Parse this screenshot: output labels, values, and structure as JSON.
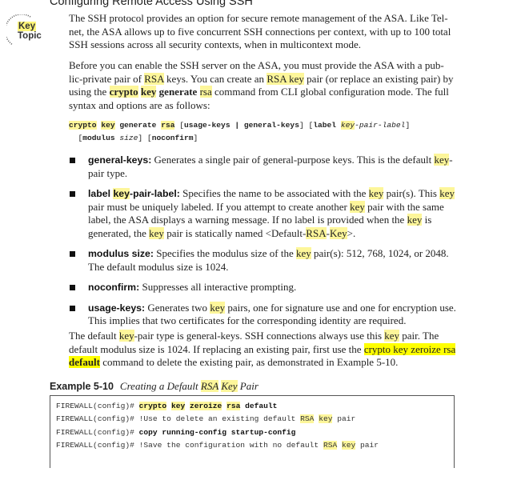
{
  "section": {
    "heading": "Configuring Remote Access Using SSH",
    "key_topic": {
      "line1": "Key",
      "line2": "Topic"
    }
  },
  "paragraph1": {
    "text": "The SSH protocol provides an option for secure remote management of the ASA. Like Tel-net, the ASA allows up to five concurrent SSH connections per context, with up to 100 total SSH sessions across all security contexts, when in multicontext mode."
  },
  "paragraph2": {
    "t1": "Before you can enable the SSH server on the ASA, you must provide the ASA with a pub-lic-private pair of ",
    "rsa1": "RSA",
    "t2": " keys. You can create an ",
    "rsa2": "RSA",
    "sp": " ",
    "key1": "key",
    "t3": " pair (or replace an existing pair) by using the ",
    "crypto": "crypto",
    "key2": "key",
    "generate": "generate",
    "rsa3": "rsa",
    "t4": " command from CLI global configuration mode. The full syntax and options are as follows:"
  },
  "syntax": {
    "crypto": "crypto",
    "key": "key",
    "generate": "generate",
    "rsa": "rsa",
    "ob1": "[",
    "usage_keys": "usage-keys",
    "pipe": " | ",
    "general_keys": "general-keys",
    "cb1": "]",
    "ob2": "[",
    "label": "label",
    "keyword_key": "key",
    "pair_label": "-pair-label",
    "cb2": "]",
    "ob3": "[",
    "modulus": "modulus",
    "size": "size",
    "cb3": "]",
    "ob4": "[",
    "noconfirm": "noconfirm",
    "cb4": "]"
  },
  "bullets": [
    {
      "term": "general-keys:",
      "t1": " Generates a single pair of general-purpose keys. This is the default ",
      "k1": "key",
      "t2": "-pair type."
    },
    {
      "term_pre": "label ",
      "term_key": "key",
      "term_post": "-pair-label:",
      "t1": " Specifies the name to be associated with the ",
      "k1": "key",
      "t2": " pair(s). This ",
      "k2": "key",
      "t3": " pair must be uniquely labeled. If you attempt to create another ",
      "k3": "key",
      "t4": " pair with the same label, the ASA displays a warning message. If no label is provided when the ",
      "k4": "key",
      "t5": " is generated, the ",
      "k5": "key",
      "t6": " pair is statically named <Default-",
      "rsa": "RSA",
      "dash": "-",
      "k6": "Key",
      "t7": ">."
    },
    {
      "term": "modulus size:",
      "t1": " Specifies the modulus size of the ",
      "k1": "key",
      "t2": " pair(s): 512, 768, 1024, or 2048. The default modulus size is 1024."
    },
    {
      "term": "noconfirm:",
      "t1": " Suppresses all interactive prompting."
    },
    {
      "term": "usage-keys:",
      "t1": " Generates two ",
      "k1": "key",
      "t2": " pairs, one for signature use and one for encryption use. This implies that two certificates for the corresponding identity are required."
    }
  ],
  "paragraph3": {
    "t1": "The default ",
    "k1": "key",
    "t2": "-pair type is general-keys. SSH connections always use this ",
    "k2": "key",
    "t3": " pair. The default modulus size is 1024. If replacing an existing pair, first use the ",
    "cmd_hl": "crypto key zeroize rsa",
    "sp": " ",
    "cmd_hl_bold": "default",
    "t4": " command to delete the existing pair, as demonstrated in Example 5-10."
  },
  "example": {
    "number": "Example 5-10",
    "caption_pre": "Creating a Default ",
    "caption_rsa": "RSA",
    "caption_sp": " ",
    "caption_key": "Key",
    "caption_post": " Pair",
    "lines": [
      {
        "prompt": "FIREWALL(config)# ",
        "w1": "crypto",
        "w2": "key",
        "w3": "zeroize",
        "w4": "rsa",
        "w5": "default"
      },
      {
        "prompt": "FIREWALL(config)# ",
        "t1": "!Use to delete an existing default ",
        "rsa": "RSA",
        "k": "key",
        "t2": " pair"
      },
      {
        "prompt": "FIREWALL(config)# ",
        "cmd": "copy running-config startup-config"
      },
      {
        "prompt": "FIREWALL(config)# ",
        "t1": "!Save the configuration with no default ",
        "rsa": "RSA",
        "k": "key",
        "t2": " pair"
      }
    ]
  },
  "colors": {
    "highlight": "#fdf69a",
    "highlight_strong": "#ffff00",
    "text": "#222222"
  }
}
